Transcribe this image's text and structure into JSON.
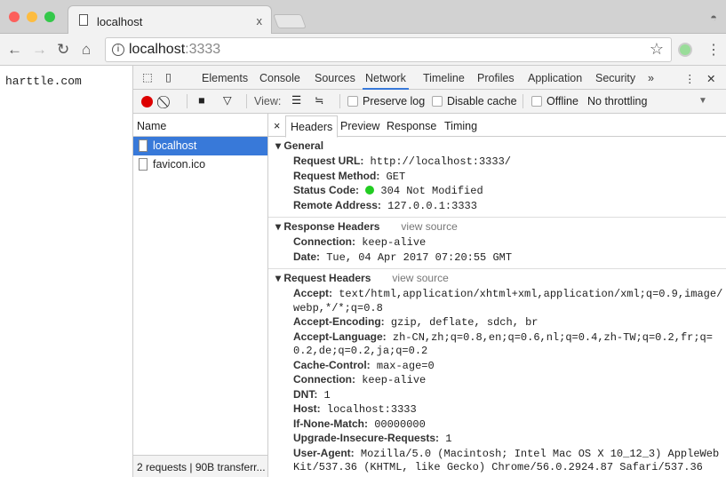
{
  "browser": {
    "tab_title": "localhost",
    "tab_close": "x",
    "url_host": "localhost",
    "url_port": ":3333"
  },
  "page": {
    "text": "harttle.com"
  },
  "devtools": {
    "tabs": [
      "Elements",
      "Console",
      "Sources",
      "Network",
      "Timeline",
      "Profiles",
      "Application",
      "Security"
    ],
    "active_tab": "Network",
    "more": "»",
    "close": "✕",
    "toolbar": {
      "view_label": "View:",
      "preserve_log": "Preserve log",
      "disable_cache": "Disable cache",
      "offline": "Offline",
      "throttling": "No throttling"
    },
    "list": {
      "header": "Name",
      "items": [
        "localhost",
        "favicon.ico"
      ],
      "status": "2 requests | 90B transferr..."
    },
    "detail": {
      "tabs": [
        "Headers",
        "Preview",
        "Response",
        "Timing"
      ],
      "close": "×",
      "general": {
        "title": "General",
        "rows": [
          {
            "k": "Request URL:",
            "v": "http://localhost:3333/"
          },
          {
            "k": "Request Method:",
            "v": "GET"
          },
          {
            "k": "Status Code:",
            "v": "304 Not Modified"
          },
          {
            "k": "Remote Address:",
            "v": "127.0.0.1:3333"
          }
        ]
      },
      "response": {
        "title": "Response Headers",
        "view_source": "view source",
        "rows": [
          {
            "k": "Connection:",
            "v": "keep-alive"
          },
          {
            "k": "Date:",
            "v": "Tue, 04 Apr 2017 07:20:55 GMT"
          }
        ]
      },
      "request": {
        "title": "Request Headers",
        "view_source": "view source",
        "rows": [
          {
            "k": "Accept:",
            "v": "text/html,application/xhtml+xml,application/xml;q=0.9,image/webp,*/*;q=0.8"
          },
          {
            "k": "Accept-Encoding:",
            "v": "gzip, deflate, sdch, br"
          },
          {
            "k": "Accept-Language:",
            "v": "zh-CN,zh;q=0.8,en;q=0.6,nl;q=0.4,zh-TW;q=0.2,fr;q=0.2,de;q=0.2,ja;q=0.2"
          },
          {
            "k": "Cache-Control:",
            "v": "max-age=0"
          },
          {
            "k": "Connection:",
            "v": "keep-alive"
          },
          {
            "k": "DNT:",
            "v": "1"
          },
          {
            "k": "Host:",
            "v": "localhost:3333"
          },
          {
            "k": "If-None-Match:",
            "v": "00000000"
          },
          {
            "k": "Upgrade-Insecure-Requests:",
            "v": "1"
          },
          {
            "k": "User-Agent:",
            "v": "Mozilla/5.0 (Macintosh; Intel Mac OS X 10_12_3) AppleWebKit/537.36 (KHTML, like Gecko) Chrome/56.0.2924.87 Safari/537.36"
          }
        ]
      }
    }
  }
}
